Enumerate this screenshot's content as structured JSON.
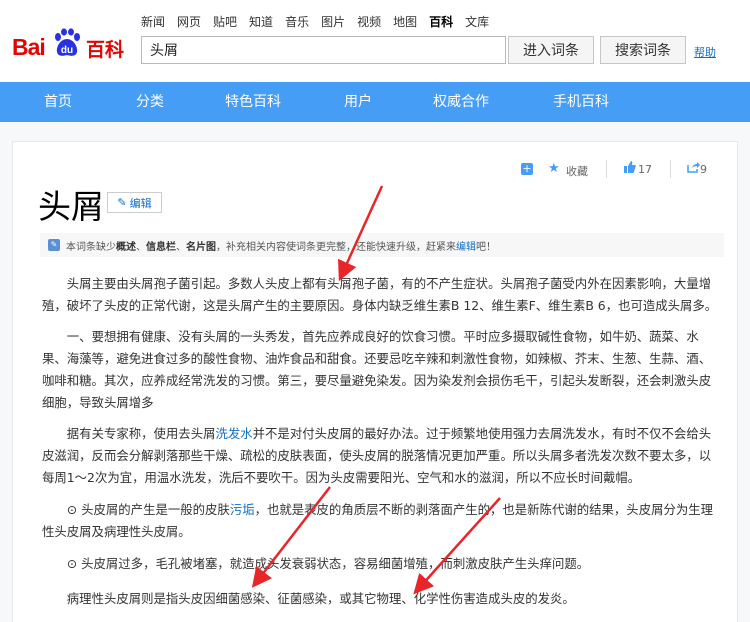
{
  "header": {
    "logo": {
      "part1": "Bai",
      "part2": "du",
      "part3": "百科"
    },
    "nav_links": [
      "新闻",
      "网页",
      "贴吧",
      "知道",
      "音乐",
      "图片",
      "视频",
      "地图",
      "百科",
      "文库"
    ],
    "active_nav": "百科",
    "search": {
      "value": "头屑"
    },
    "enter_button": "进入词条",
    "search_button": "搜索词条",
    "help": "帮助"
  },
  "main_nav": [
    "首页",
    "分类",
    "特色百科",
    "用户",
    "权威合作",
    "手机百科"
  ],
  "tools": {
    "favorite": "收藏",
    "likes": "17",
    "shares": "9"
  },
  "article": {
    "title": "头屑",
    "edit": "编辑",
    "notice": {
      "pre": "本词条缺少",
      "items": [
        "概述",
        "信息栏",
        "名片图"
      ],
      "mid": "，补充相关内容使词条更完整，还能快速升级，赶紧来",
      "link": "编辑",
      "post": "吧！"
    },
    "paragraphs": [
      "头屑主要由头屑孢子菌引起。多数人头皮上都有头屑孢子菌，有的不产生症状。头屑孢子菌受内外在因素影响，大量增殖，破坏了头皮的正常代谢，这是头屑产生的主要原因。身体内缺乏维生素B 12、维生素F、维生素B 6，也可造成头屑多。",
      "一、要想拥有健康、没有头屑的一头秀发，首先应养成良好的饮食习惯。平时应多摄取碱性食物，如牛奶、蔬菜、水果、海藻等，避免进食过多的酸性食物、油炸食品和甜食。还要忌吃辛辣和刺激性食物，如辣椒、芥末、生葱、生蒜、酒、咖啡和糖。其次，应养成经常洗发的习惯。第三，要尽量避免染发。因为染发剂会损伤毛干，引起头发断裂，还会刺激头皮细胞，导致头屑增多"
    ],
    "para3": {
      "pre": "据有关专家称，使用去头屑",
      "link": "洗发水",
      "post": "并不是对付头皮屑的最好办法。过于频繁地使用强力去屑洗发水，有时不仅不会给头皮滋润，反而会分解剥落那些干燥、疏松的皮肤表面，使头皮屑的脱落情况更加严重。所以头屑多者洗发次数不要太多，以每周1～2次为宜，用温水洗发，洗后不要吹干。因为头皮需要阳光、空气和水的滋润，所以不应长时间戴帽。"
    },
    "para4": {
      "pre": "⊙ 头皮屑的产生是一般的皮肤",
      "link": "污垢",
      "post": "，也就是表皮的角质层不断的剥落面产生的，也是新陈代谢的结果，头皮屑分为生理性头皮屑及病理性头皮屑。"
    },
    "para5": "⊙ 头皮屑过多，毛孔被堵塞，就造成头发衰弱状态，容易细菌增殖，而刺激皮肤产生头痒问题。",
    "para6": "病理性头皮屑则是指头皮因细菌感染、征菌感染，或其它物理、化学性伤害造成头皮的发炎。"
  },
  "colors": {
    "accent": "#459df5",
    "brand_red": "#e10601",
    "link": "#136ec2",
    "arrow": "#e8262a"
  }
}
